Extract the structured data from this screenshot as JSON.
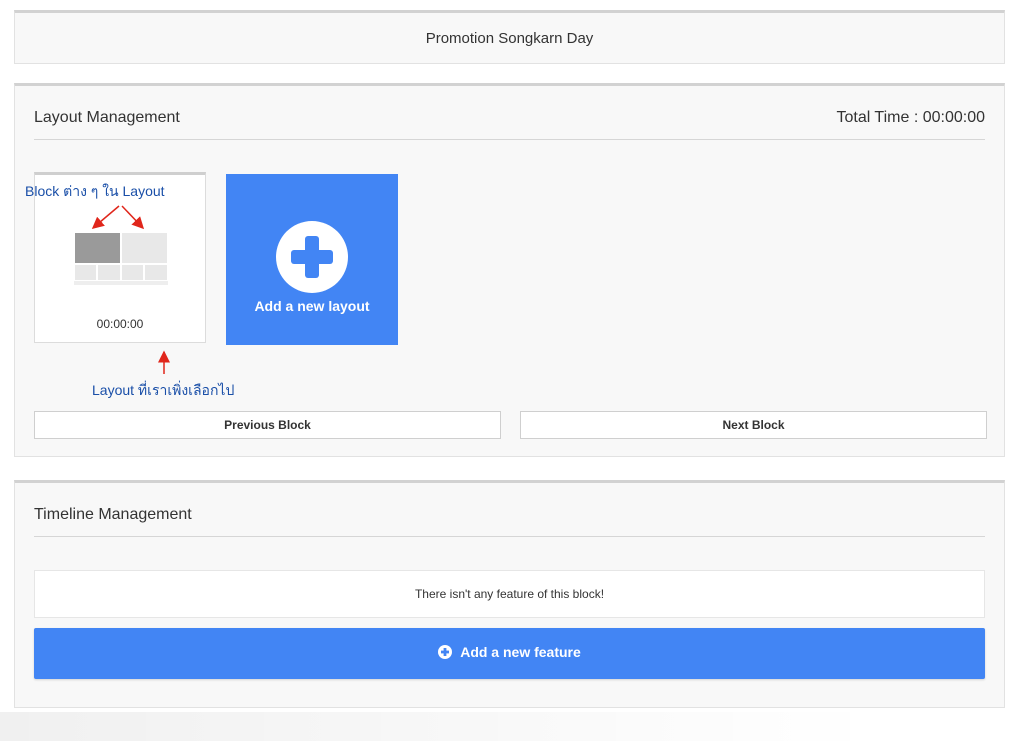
{
  "header": {
    "title": "Promotion Songkarn Day"
  },
  "layout_management": {
    "title": "Layout Management",
    "total_time": "Total Time : 00:00:00",
    "selected_layout": {
      "time": "00:00:00"
    },
    "annotations": {
      "blocks_in_layout": "Block ต่าง ๆ ใน Layout",
      "selected_layout": "Layout ที่เราเพิ่งเลือกไป"
    },
    "add_layout_label": "Add a new layout",
    "previous_block_label": "Previous Block",
    "next_block_label": "Next Block"
  },
  "timeline_management": {
    "title": "Timeline Management",
    "empty_message": "There isn't any feature of this block!",
    "add_feature_label": "Add a new feature"
  },
  "colors": {
    "accent": "#4285f4",
    "annotation_text": "#1a4fa8",
    "annotation_arrow": "#e0261b"
  }
}
